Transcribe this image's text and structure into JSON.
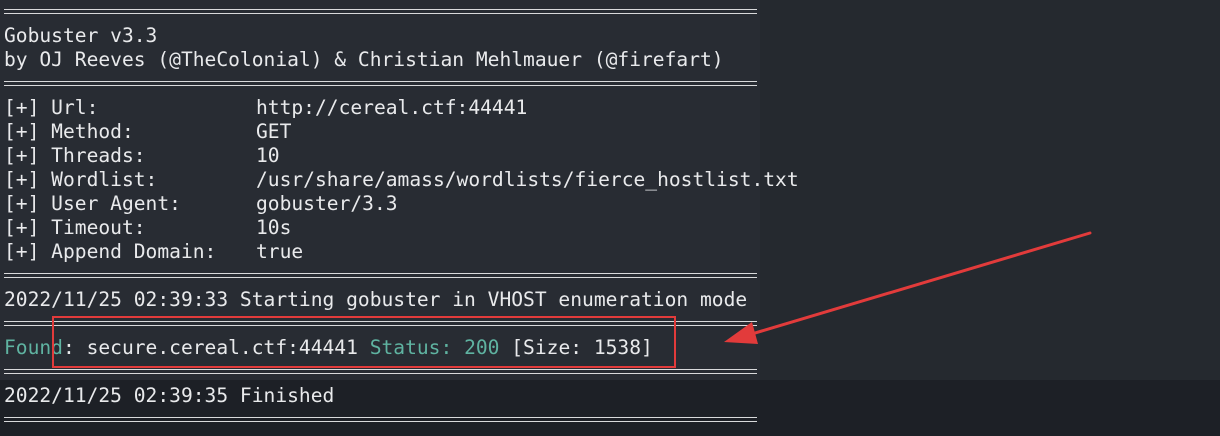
{
  "banner": {
    "title": "Gobuster v3.3",
    "credits": "by OJ Reeves (@TheColonial) & Christian Mehlmauer (@firefart)"
  },
  "config": [
    {
      "key": "[+] Url:",
      "value": "http://cereal.ctf:44441"
    },
    {
      "key": "[+] Method:",
      "value": "GET"
    },
    {
      "key": "[+] Threads:",
      "value": "10"
    },
    {
      "key": "[+] Wordlist:",
      "value": "/usr/share/amass/wordlists/fierce_hostlist.txt"
    },
    {
      "key": "[+] User Agent:",
      "value": "gobuster/3.3"
    },
    {
      "key": "[+] Timeout:",
      "value": "10s"
    },
    {
      "key": "[+] Append Domain:",
      "value": "true"
    }
  ],
  "start_line": "2022/11/25 02:39:33 Starting gobuster in VHOST enumeration mode",
  "found": {
    "label": "Found",
    "colon": ":",
    "host": " secure.cereal.ctf:44441 ",
    "status_label": "Status: 200",
    "size": " [Size: 1538]"
  },
  "finished_line": "2022/11/25 02:39:35 Finished",
  "colors": {
    "background": "#22262c",
    "text": "#e9eaec",
    "found_green": "#5fb3a1",
    "annotation_red": "#e23b3b"
  }
}
